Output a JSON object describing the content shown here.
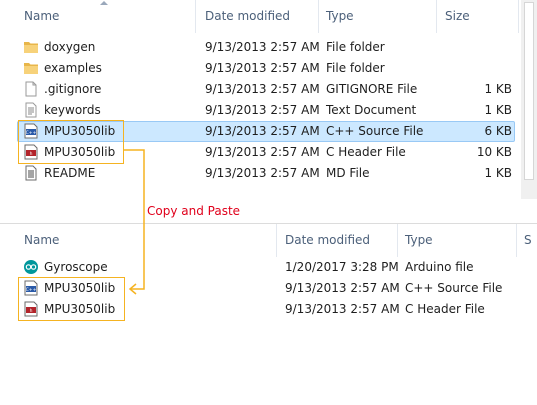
{
  "top": {
    "columns": [
      "Name",
      "Date modified",
      "Type",
      "Size"
    ],
    "files": [
      {
        "name": "doxygen",
        "date": "9/13/2013 2:57 AM",
        "type": "File folder",
        "size": "",
        "icon": "folder-icon"
      },
      {
        "name": "examples",
        "date": "9/13/2013 2:57 AM",
        "type": "File folder",
        "size": "",
        "icon": "folder-icon"
      },
      {
        "name": ".gitignore",
        "date": "9/13/2013 2:57 AM",
        "type": "GITIGNORE File",
        "size": "1 KB",
        "icon": "blank-file-icon"
      },
      {
        "name": "keywords",
        "date": "9/13/2013 2:57 AM",
        "type": "Text Document",
        "size": "1 KB",
        "icon": "text-file-icon"
      },
      {
        "name": "MPU3050lib",
        "date": "9/13/2013 2:57 AM",
        "type": "C++ Source File",
        "size": "6 KB",
        "icon": "cpp-file-icon",
        "selected": true
      },
      {
        "name": "MPU3050lib",
        "date": "9/13/2013 2:57 AM",
        "type": "C Header File",
        "size": "10 KB",
        "icon": "header-file-icon"
      },
      {
        "name": "README",
        "date": "9/13/2013 2:57 AM",
        "type": "MD File",
        "size": "1 KB",
        "icon": "md-file-icon"
      }
    ]
  },
  "annotation": {
    "label": "Copy and Paste",
    "color": "#e0001b",
    "box_color": "#f5b321"
  },
  "bottom": {
    "columns": [
      "Name",
      "Date modified",
      "Type",
      "S"
    ],
    "files": [
      {
        "name": "Gyroscope",
        "date": "1/20/2017 3:28 PM",
        "type": "Arduino file",
        "icon": "arduino-file-icon"
      },
      {
        "name": "MPU3050lib",
        "date": "9/13/2013 2:57 AM",
        "type": "C++ Source File",
        "icon": "cpp-file-icon"
      },
      {
        "name": "MPU3050lib",
        "date": "9/13/2013 2:57 AM",
        "type": "C Header File",
        "icon": "header-file-icon"
      }
    ]
  }
}
